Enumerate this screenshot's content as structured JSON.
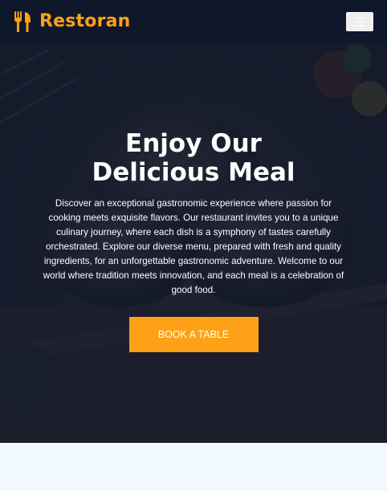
{
  "navbar": {
    "brand_name": "Restoran",
    "brand_icon": "utensils-icon",
    "menu_icon": "hamburger-menu-icon"
  },
  "hero": {
    "title_line1": "Enjoy Our",
    "title_line2": "Delicious Meal",
    "description": "Discover an exceptional gastronomic experience where passion for cooking meets exquisite flavors. Our restaurant invites you to a unique culinary journey, where each dish is a symphony of tastes carefully orchestrated. Explore our diverse menu, prepared with fresh and quality ingredients, for an unforgettable gastronomic adventure. Welcome to our world where tradition meets innovation, and each meal is a celebration of good food.",
    "cta_label": "BOOK A TABLE"
  },
  "colors": {
    "primary": "#fea116",
    "dark": "#0f172b",
    "light": "#f1f8ff"
  }
}
